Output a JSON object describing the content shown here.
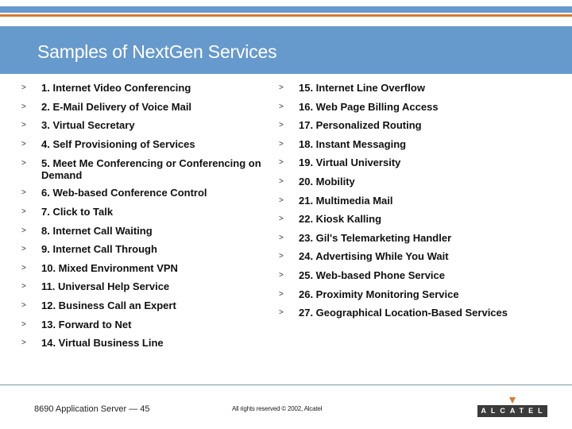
{
  "slide": {
    "title": "Samples of NextGen Services",
    "bullet_glyph": ">",
    "left_items": [
      "1. Internet Video Conferencing",
      "2. E-Mail Delivery of Voice Mail",
      "3. Virtual Secretary",
      "4. Self Provisioning of Services",
      "5. Meet Me Conferencing or Conferencing on Demand",
      "6. Web-based Conference Control",
      "7. Click to Talk",
      "8. Internet Call Waiting",
      "9. Internet Call Through",
      "10. Mixed Environment VPN",
      "11. Universal Help Service",
      "12. Business Call an Expert",
      "13. Forward to Net",
      "14. Virtual Business Line"
    ],
    "right_items": [
      "15. Internet Line Overflow",
      "16. Web Page Billing Access",
      "17. Personalized Routing",
      "18. Instant Messaging",
      "19. Virtual University",
      "20. Mobility",
      "21. Multimedia Mail",
      "22. Kiosk Kalling",
      "23. Gil's Telemarketing Handler",
      "24. Advertising While You Wait",
      "25. Web-based Phone Service",
      "26. Proximity Monitoring Service",
      "27. Geographical Location-Based Services"
    ]
  },
  "footer": {
    "left_text": "8690 Application Server — 45",
    "copyright": "All rights reserved © 2002, Alcatel",
    "logo_text": "ALCATEL"
  },
  "colors": {
    "header_blue": "#6699cc",
    "accent_orange": "#d97a2e",
    "logo_dark": "#3a3a3a"
  }
}
